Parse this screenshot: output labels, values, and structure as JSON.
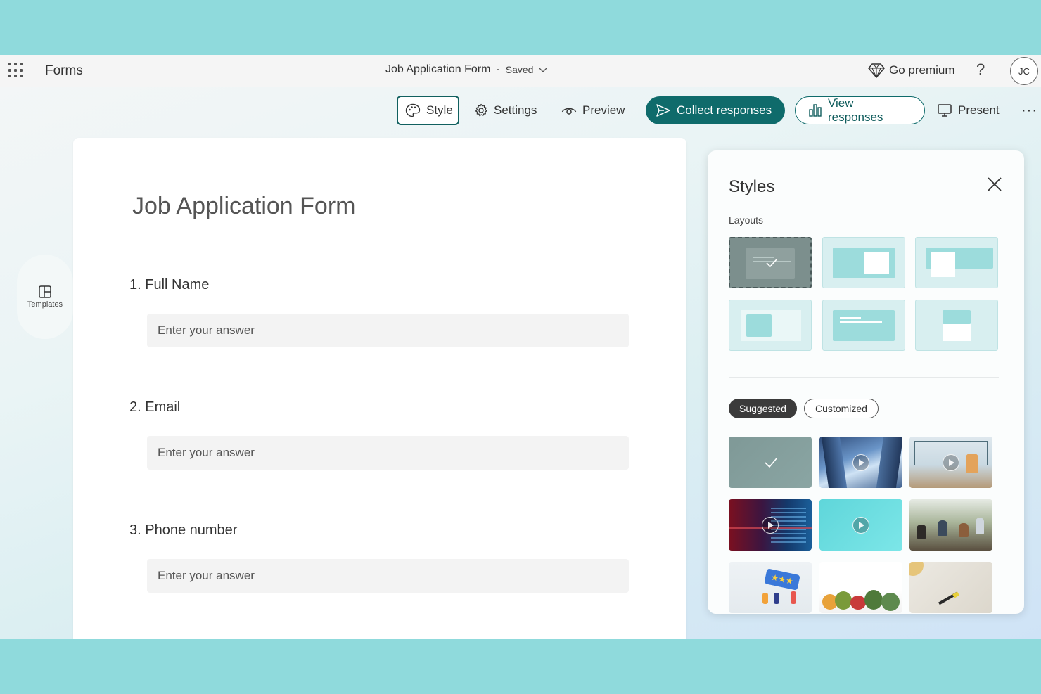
{
  "app": {
    "name": "Forms"
  },
  "document": {
    "title": "Job Application Form",
    "separator": "-",
    "status": "Saved"
  },
  "header": {
    "premium_label": "Go premium",
    "help_label": "?",
    "avatar_initials": "JC"
  },
  "toolbar": {
    "style_label": "Style",
    "settings_label": "Settings",
    "preview_label": "Preview",
    "collect_label": "Collect responses",
    "view_label": "View responses",
    "present_label": "Present",
    "more_label": "···"
  },
  "left_rail": {
    "templates_label": "Templates"
  },
  "form": {
    "title": "Job Application Form",
    "questions": [
      {
        "label": "1.  Full Name",
        "placeholder": "Enter your answer"
      },
      {
        "label": "2.  Email",
        "placeholder": "Enter your answer"
      },
      {
        "label": "3.  Phone number",
        "placeholder": "Enter your answer"
      }
    ]
  },
  "styles_panel": {
    "title": "Styles",
    "layouts_label": "Layouts",
    "layouts_selected_index": 0,
    "tabs": {
      "suggested": "Suggested",
      "customized": "Customized",
      "active": "suggested"
    },
    "themes": [
      {
        "kind": "solid-gray",
        "selected": true,
        "video": false
      },
      {
        "kind": "city-buildings",
        "selected": false,
        "video": true
      },
      {
        "kind": "office-meeting",
        "selected": false,
        "video": true
      },
      {
        "kind": "data-screen",
        "selected": false,
        "video": true
      },
      {
        "kind": "teal-gradient",
        "selected": false,
        "video": true
      },
      {
        "kind": "open-office",
        "selected": false,
        "video": false
      },
      {
        "kind": "rating-stars",
        "selected": false,
        "video": false
      },
      {
        "kind": "vegetables",
        "selected": false,
        "video": false
      },
      {
        "kind": "desk-paper",
        "selected": false,
        "video": false
      }
    ]
  },
  "colors": {
    "accent": "#0f6b6b",
    "page_background": "#8fdadc"
  }
}
